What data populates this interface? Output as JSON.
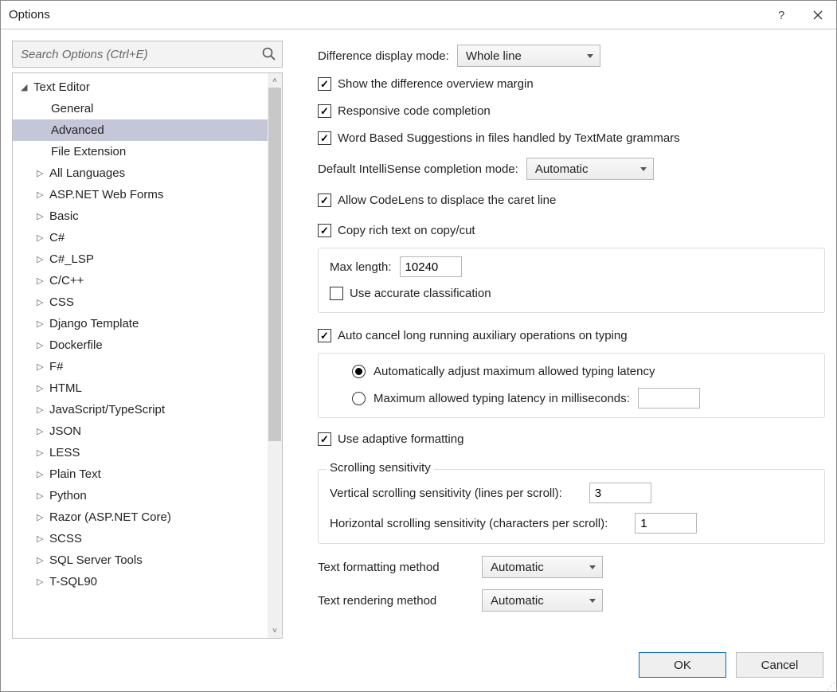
{
  "window": {
    "title": "Options"
  },
  "search": {
    "placeholder": "Search Options (Ctrl+E)"
  },
  "tree": {
    "root": "Text Editor",
    "children": [
      "General",
      "Advanced",
      "File Extension"
    ],
    "branches": [
      "All Languages",
      "ASP.NET Web Forms",
      "Basic",
      "C#",
      "C#_LSP",
      "C/C++",
      "CSS",
      "Django Template",
      "Dockerfile",
      "F#",
      "HTML",
      "JavaScript/TypeScript",
      "JSON",
      "LESS",
      "Plain Text",
      "Python",
      "Razor (ASP.NET Core)",
      "SCSS",
      "SQL Server Tools",
      "T-SQL90"
    ],
    "selected": "Advanced"
  },
  "right": {
    "diff_display_label": "Difference display mode:",
    "diff_display_value": "Whole line",
    "chk_overview": "Show the difference overview margin",
    "chk_responsive": "Responsive code completion",
    "chk_textmate": "Word Based Suggestions in files handled by TextMate grammars",
    "intellisense_label": "Default IntelliSense completion mode:",
    "intellisense_value": "Automatic",
    "chk_codelens": "Allow CodeLens to displace the caret line",
    "chk_copyrich": "Copy rich text on copy/cut",
    "maxlen_label": "Max length:",
    "maxlen_value": "10240",
    "chk_accurate": "Use accurate classification",
    "chk_autocancel": "Auto cancel long running auxiliary operations on typing",
    "radio_auto": "Automatically adjust maximum allowed typing latency",
    "radio_max": "Maximum allowed typing latency in milliseconds:",
    "radio_max_value": "",
    "chk_adaptive": "Use adaptive formatting",
    "scroll_legend": "Scrolling sensitivity",
    "vscroll_label": "Vertical scrolling sensitivity (lines per scroll):",
    "vscroll_value": "3",
    "hscroll_label": "Horizontal scrolling sensitivity (characters per scroll):",
    "hscroll_value": "1",
    "fmt_label": "Text formatting method",
    "fmt_value": "Automatic",
    "render_label": "Text rendering method",
    "render_value": "Automatic"
  },
  "buttons": {
    "ok": "OK",
    "cancel": "Cancel"
  }
}
